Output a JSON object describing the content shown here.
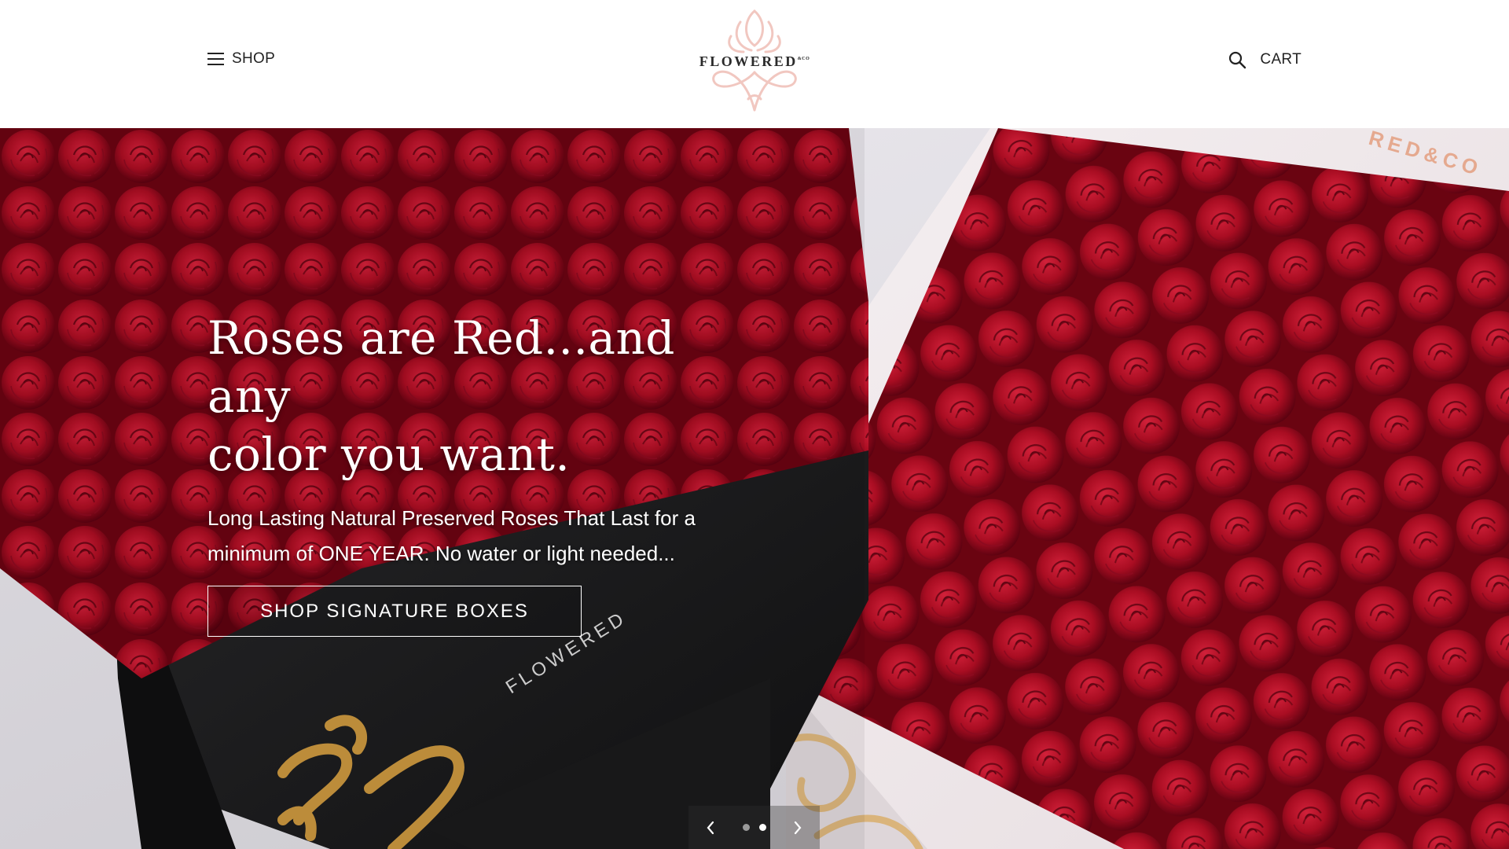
{
  "header": {
    "shop_label": "SHOP",
    "logo_text": "FLOWERED",
    "logo_suffix": "&CO",
    "cart_label": "CART"
  },
  "hero": {
    "title_line1": "Roses are Red...and any",
    "title_line2": "color you want.",
    "description": "Long Lasting Natural Preserved Roses That Last for a minimum of ONE YEAR. No water or light needed...",
    "button_label": "SHOP SIGNATURE BOXES",
    "box_brand": "FLOWERED"
  },
  "slider": {
    "slide_count": 2,
    "active_slide": 2
  },
  "colors": {
    "accent_pink": "#f1c7c0",
    "rose_red": "#a50a1e",
    "box_black": "#1e1e1f",
    "box_white": "#f2ecee",
    "gold": "#c8953e"
  },
  "icons": [
    "hamburger-icon",
    "search-icon",
    "chevron-left-icon",
    "chevron-right-icon"
  ]
}
